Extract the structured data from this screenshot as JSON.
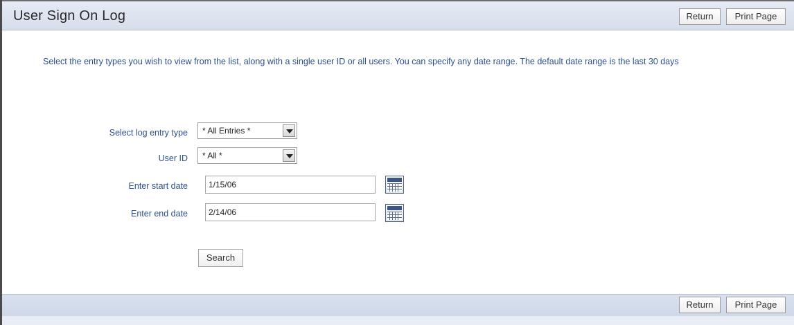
{
  "header": {
    "title": "User Sign On Log",
    "return_label": "Return",
    "print_label": "Print Page"
  },
  "intro": {
    "text": "Select the entry types you wish to view from the list, along with a single user ID or all users. You can specify any date range. The default date range is the last 30 days"
  },
  "form": {
    "log_type_label": "Select log entry type",
    "log_type_value": "* All Entries *",
    "user_id_label": "User ID",
    "user_id_value": "* All *",
    "start_date_label": "Enter start date",
    "start_date_value": "1/15/06",
    "end_date_label": "Enter end date",
    "end_date_value": "2/14/06",
    "search_label": "Search"
  },
  "footer": {
    "return_label": "Return",
    "print_label": "Print Page"
  },
  "colors": {
    "header_bg": "#d9e1ef",
    "label_text": "#2d4f8a"
  },
  "icons": {
    "calendar": "calendar-icon",
    "dropdown": "chevron-down-icon"
  }
}
